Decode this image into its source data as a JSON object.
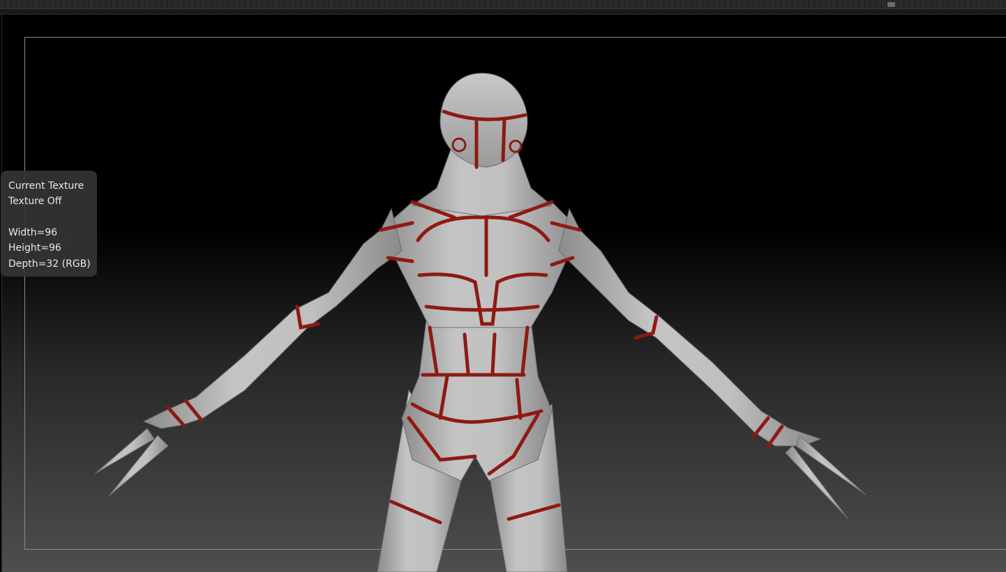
{
  "viewport": {
    "model": "alien-creature-sculpt",
    "surface_color": "#b4b4b4",
    "polygroup_line_color": "#8e1a12"
  },
  "texture_tooltip": {
    "title": "Current Texture",
    "status": "Texture Off",
    "width": "Width=96",
    "height": "Height=96",
    "depth": "Depth=32 (RGB)"
  }
}
